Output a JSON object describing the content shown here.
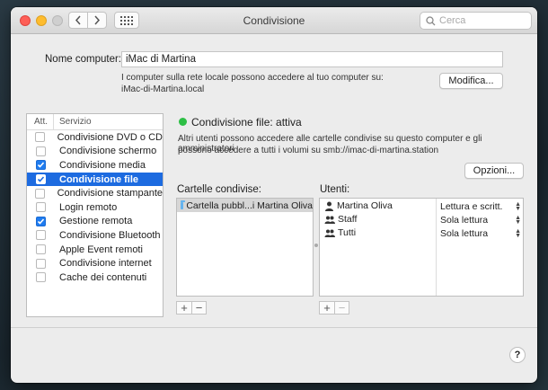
{
  "window": {
    "title": "Condivisione"
  },
  "search": {
    "placeholder": "Cerca"
  },
  "computer_name": {
    "label": "Nome computer:",
    "value": "iMac di Martina",
    "info_line1": "I computer sulla rete locale possono accedere al tuo computer su:",
    "info_line2": "iMac-di-Martina.local",
    "edit_button": "Modifica..."
  },
  "services": {
    "header_on": "Att.",
    "header_service": "Servizio",
    "items": [
      {
        "label": "Condivisione DVD o CD",
        "checked": false,
        "selected": false
      },
      {
        "label": "Condivisione schermo",
        "checked": false,
        "selected": false
      },
      {
        "label": "Condivisione media",
        "checked": true,
        "selected": false
      },
      {
        "label": "Condivisione file",
        "checked": true,
        "selected": true
      },
      {
        "label": "Condivisione stampante",
        "checked": false,
        "selected": false
      },
      {
        "label": "Login remoto",
        "checked": false,
        "selected": false
      },
      {
        "label": "Gestione remota",
        "checked": true,
        "selected": false
      },
      {
        "label": "Condivisione Bluetooth",
        "checked": false,
        "selected": false
      },
      {
        "label": "Apple Event remoti",
        "checked": false,
        "selected": false
      },
      {
        "label": "Condivisione internet",
        "checked": false,
        "selected": false
      },
      {
        "label": "Cache dei contenuti",
        "checked": false,
        "selected": false
      }
    ]
  },
  "status": {
    "text": "Condivisione file: attiva",
    "color": "#2dbf45",
    "desc_line1": "Altri utenti possono accedere alle cartelle condivise su questo computer e gli amministratori",
    "desc_line2": "possono accedere a tutti i volumi su smb://imac-di-martina.station",
    "options_button": "Opzioni..."
  },
  "shared_folders": {
    "label": "Cartelle condivise:",
    "items": [
      "Cartella pubbl...i Martina Oliva"
    ]
  },
  "users": {
    "label": "Utenti:",
    "items": [
      {
        "name": "Martina Oliva",
        "icon": "user-icon",
        "permission": "Lettura e scritt."
      },
      {
        "name": "Staff",
        "icon": "group-icon",
        "permission": "Sola lettura"
      },
      {
        "name": "Tutti",
        "icon": "group-icon",
        "permission": "Sola lettura"
      }
    ]
  },
  "controls": {
    "add": "+",
    "remove": "−"
  },
  "help": "?",
  "colors": {
    "accent": "#1d6be0",
    "checkbox": "#1f7cf0"
  }
}
